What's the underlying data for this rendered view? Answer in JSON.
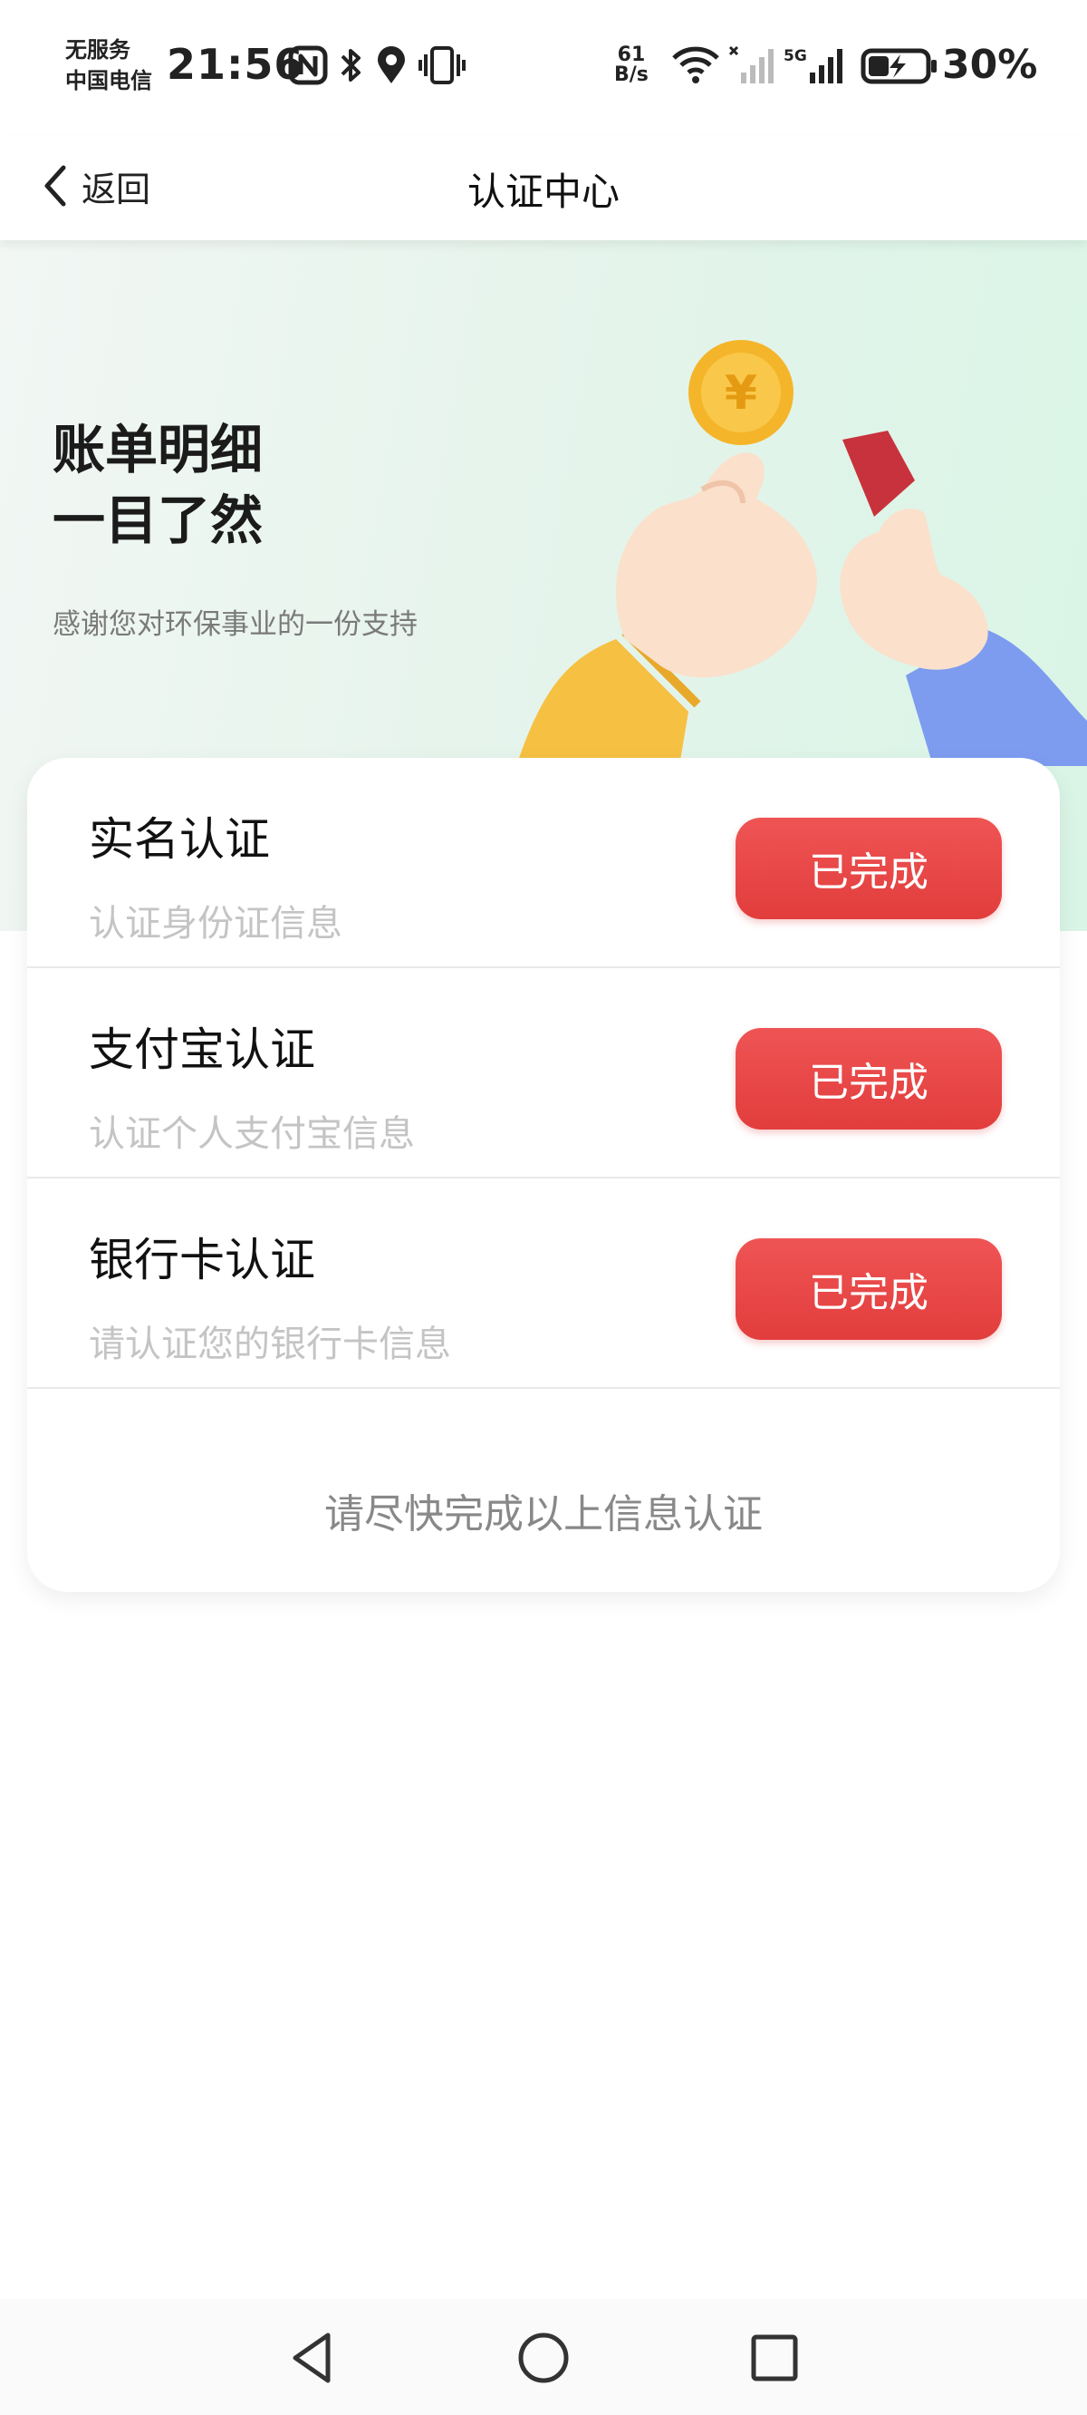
{
  "status_bar": {
    "carrier_line1": "无服务",
    "carrier_line2": "中国电信",
    "time": "21:56",
    "net_speed_value": "61",
    "net_speed_unit": "B/s",
    "network_type": "5G",
    "battery_percent": "30%"
  },
  "nav": {
    "back_label": "返回",
    "title": "认证中心"
  },
  "banner": {
    "title_line1": "账单明细",
    "title_line2": "一目了然",
    "subtitle": "感谢您对环保事业的一份支持",
    "coin_symbol": "¥"
  },
  "verification": {
    "items": [
      {
        "title": "实名认证",
        "description": "认证身份证信息",
        "status": "已完成"
      },
      {
        "title": "支付宝认证",
        "description": "认证个人支付宝信息",
        "status": "已完成"
      },
      {
        "title": "银行卡认证",
        "description": "请认证您的银行卡信息",
        "status": "已完成"
      }
    ],
    "footer_note": "请尽快完成以上信息认证"
  },
  "colors": {
    "accent": "#e84646",
    "banner_bg": "#e2f5ea",
    "muted_text": "#c4c4c4"
  },
  "icons": [
    "nfc-icon",
    "bluetooth-icon",
    "location-icon",
    "vibrate-icon",
    "wifi-icon",
    "signal-icon",
    "battery-icon",
    "back-chevron-icon",
    "nav-back-icon",
    "nav-home-icon",
    "nav-recents-icon"
  ]
}
